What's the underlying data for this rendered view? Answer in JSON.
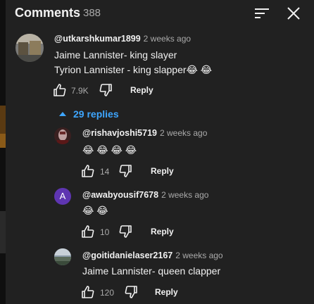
{
  "header": {
    "title": "Comments",
    "count": "388"
  },
  "comments": [
    {
      "author": "@utkarshkumar1899",
      "time": "2 weeks ago",
      "lines": [
        "Jaime Lannister- king slayer",
        "Tyrion Lannister - king slapper😂 😂"
      ],
      "likes": "7.9K",
      "reply_label": "Reply",
      "avatar_icon": "photo-avatar-icon"
    }
  ],
  "replies_toggle": "29 replies",
  "replies": [
    {
      "author": "@rishavjoshi5719",
      "time": "2 weeks ago",
      "text": "😂 😂 😂 😂",
      "likes": "14",
      "reply_label": "Reply",
      "avatar_icon": "photo-avatar-icon"
    },
    {
      "author": "@awabyousif7678",
      "time": "2 weeks ago",
      "text": "😂 😂",
      "likes": "10",
      "reply_label": "Reply",
      "avatar_letter": "A",
      "avatar_color": "#5e35b1"
    },
    {
      "author": "@goitidanielaser2167",
      "time": "2 weeks ago",
      "text": "Jaime Lannister- queen clapper",
      "likes": "120",
      "reply_label": "Reply",
      "avatar_icon": "photo-avatar-icon"
    }
  ],
  "colors": {
    "background": "#212121",
    "accent": "#3ea6ff",
    "secondary_text": "#aaaaaa"
  }
}
